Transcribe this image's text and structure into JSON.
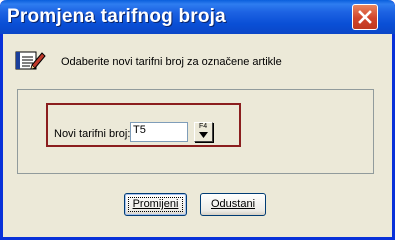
{
  "window": {
    "title": "Promjena tarifnog broja",
    "close_label": "close"
  },
  "header": {
    "icon": "notebook-pen-icon",
    "text": "Odaberite novi tarifni broj za označene artikle"
  },
  "form": {
    "field_label": "Novi tarifni broj:",
    "field_value": "T5",
    "lookup_key": "F4"
  },
  "buttons": {
    "confirm_label": "Promijeni",
    "cancel_label": "Odustani"
  },
  "colors": {
    "titlebar": "#0a4fd6",
    "frame_border": "#8b1e1e",
    "close_button": "#d1442b"
  }
}
